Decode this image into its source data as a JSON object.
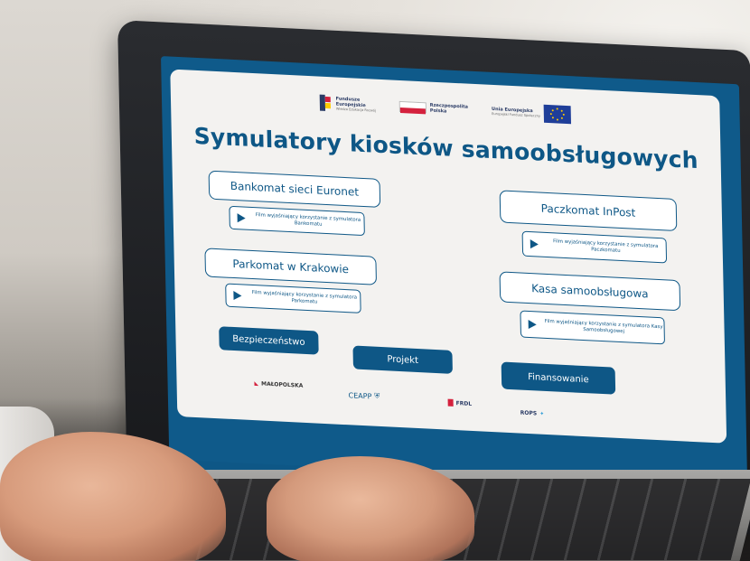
{
  "screen": {
    "header_logos": {
      "fe_line1": "Fundusze",
      "fe_line2": "Europejskie",
      "fe_sub": "Wiedza Edukacja Rozwój",
      "pl_line1": "Rzeczpospolita",
      "pl_line2": "Polska",
      "eu_line1": "Unia Europejska",
      "eu_sub": "Europejski Fundusz Społeczny"
    },
    "title": "Symulatory kiosków samoobsługowych",
    "simulators": [
      {
        "label": "Bankomat sieci Euronet",
        "film": "Film wyjaśniający korzystanie z symulatora Bankomatu"
      },
      {
        "label": "Paczkomat InPost",
        "film": "Film wyjaśniający korzystanie z symulatora Paczkomatu"
      },
      {
        "label": "Parkomat w Krakowie",
        "film": "Film wyjaśniający korzystanie z symulatora Parkomatu"
      },
      {
        "label": "Kasa samoobsługowa",
        "film": "Film wyjaśniający korzystanie z symulatora Kasy Samoobsługowej"
      }
    ],
    "nav": {
      "security": "Bezpieczeństwo",
      "project": "Projekt",
      "funding": "Finansowanie"
    },
    "footer_logos": {
      "malopolska": "MAŁOPOLSKA",
      "ceapp": "CEAPP",
      "frdl": "FRDL",
      "rops": "ROPS"
    }
  },
  "colors": {
    "primary": "#0e5786",
    "card_bg": "#f3f2f0",
    "pl_red": "#d4213d",
    "eu_blue": "#1f3e99",
    "eu_star": "#ffcc00"
  }
}
